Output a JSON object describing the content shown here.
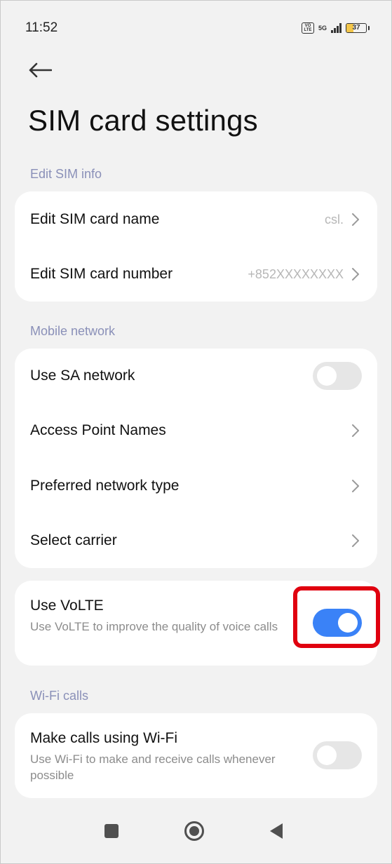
{
  "status_bar": {
    "time": "11:52",
    "network": "5G",
    "battery_level": "37",
    "battery_fraction": 0.37
  },
  "title": "SIM card settings",
  "sections": {
    "edit_sim_info": {
      "label": "Edit SIM info",
      "name_row": {
        "label": "Edit SIM card name",
        "value": "csl."
      },
      "number_row": {
        "label": "Edit SIM card number",
        "value": "+852XXXXXXXX"
      }
    },
    "mobile_network": {
      "label": "Mobile network",
      "sa_row": {
        "label": "Use SA network",
        "enabled": false
      },
      "apn_row": {
        "label": "Access Point Names"
      },
      "network_type_row": {
        "label": "Preferred network type"
      },
      "carrier_row": {
        "label": "Select carrier"
      }
    },
    "volte": {
      "title": "Use VoLTE",
      "description": "Use VoLTE to improve the quality of voice calls",
      "enabled": true
    },
    "wifi_calls": {
      "label": "Wi-Fi calls",
      "row": {
        "title": "Make calls using Wi-Fi",
        "description": "Use Wi-Fi to make and receive calls whenever possible",
        "enabled": false
      }
    }
  },
  "colors": {
    "accent": "#3a82f7",
    "highlight": "#e0000f",
    "section_label": "#8a90b8"
  },
  "nav": {
    "recents_icon": "square-icon",
    "home_icon": "circle-icon",
    "back_icon": "triangle-icon"
  }
}
